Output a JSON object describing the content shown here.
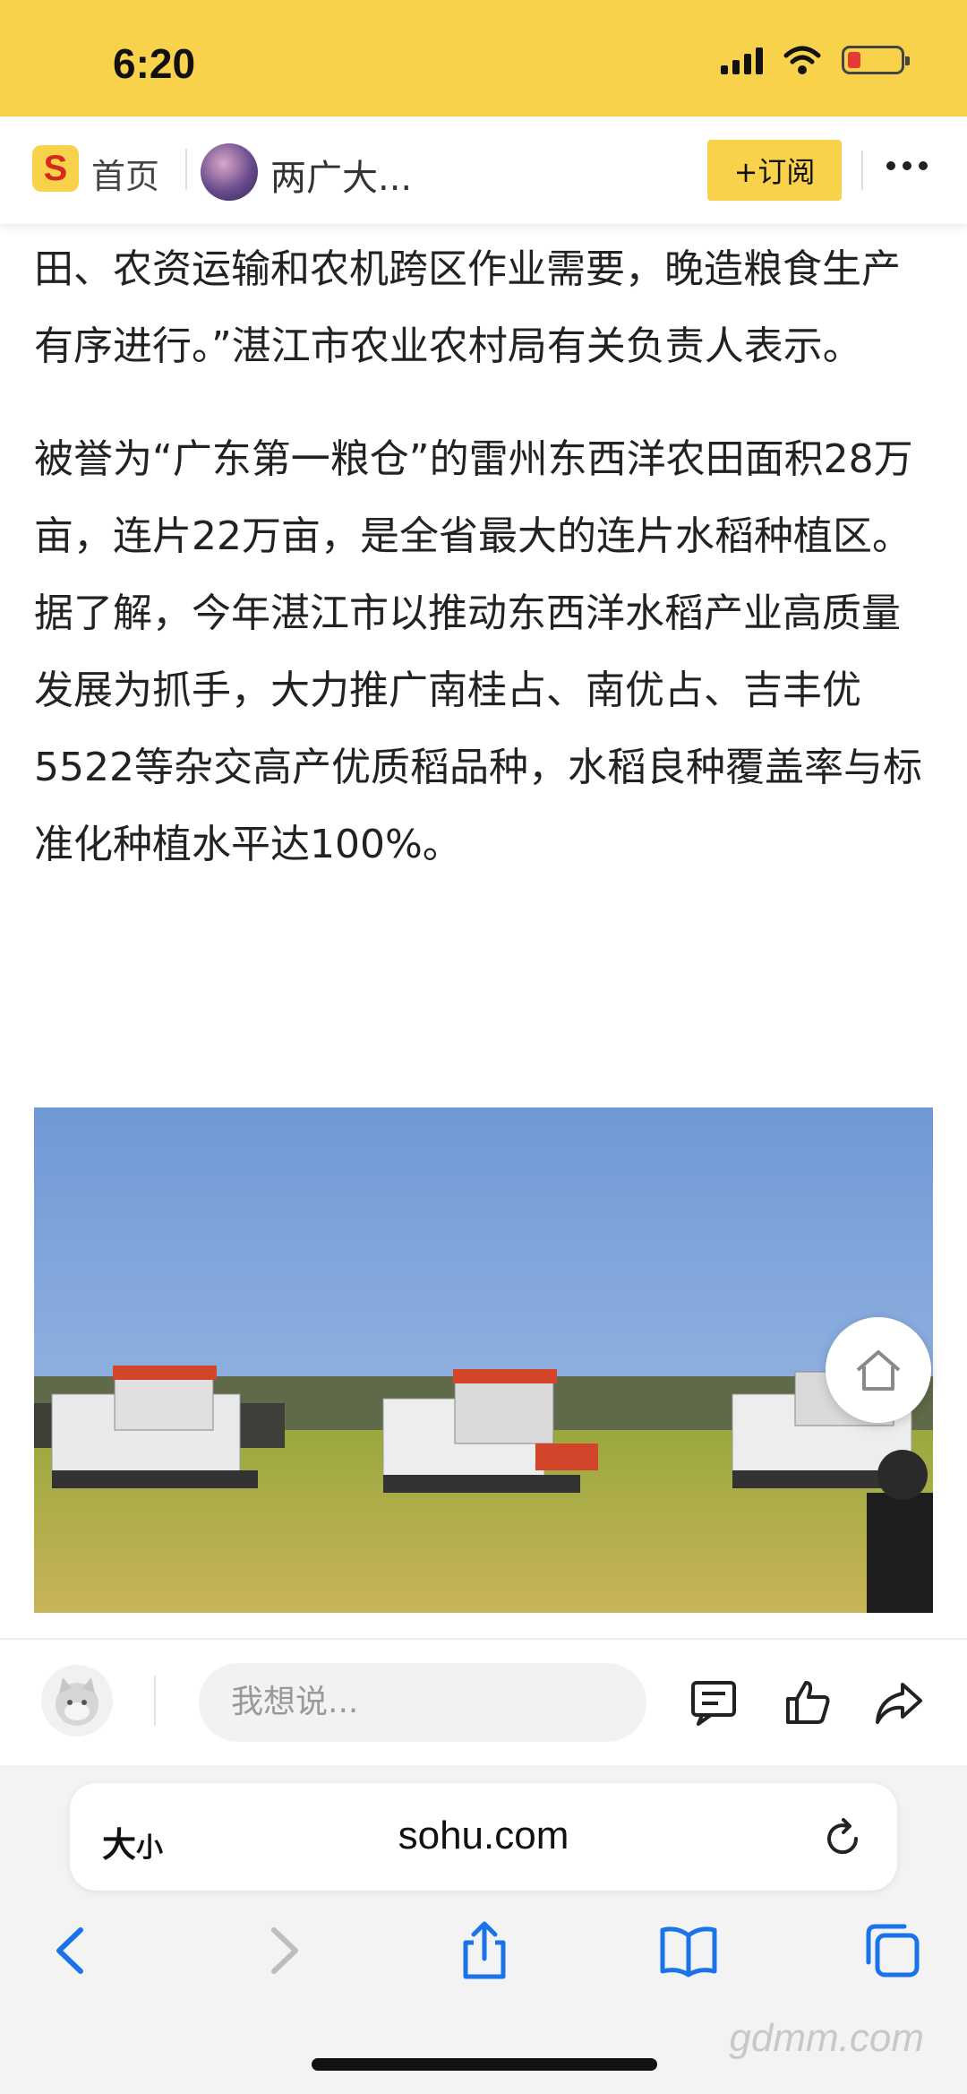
{
  "status_bar": {
    "time": "6:20"
  },
  "header": {
    "logo_text": "S",
    "home_label": "首页",
    "channel_name": "两广大...",
    "subscribe_label": "+订阅"
  },
  "article": {
    "paragraph1": "田、农资运输和农机跨区作业需要，晚造粮食生产有序进行。”湛江市农业农村局有关负责人表示。",
    "paragraph2": "被誉为“广东第一粮仓”的雷州东西洋农田面积28万亩，连片22万亩，是全省最大的连片水稻种植区。据了解，今年湛江市以推动东西洋水稻产业高质量发展为抓手，大力推广南桂占、南优占、吉丰优5522等杂交高产优质稻品种，水稻良种覆盖率与标准化种植水平达100%。"
  },
  "comment_bar": {
    "placeholder": "我想说..."
  },
  "browser": {
    "text_size_big": "大",
    "text_size_small": "小",
    "url": "sohu.com"
  },
  "watermark": "gdmm.com",
  "colors": {
    "accent": "#f7d24a",
    "ios_blue": "#1a73e8"
  }
}
